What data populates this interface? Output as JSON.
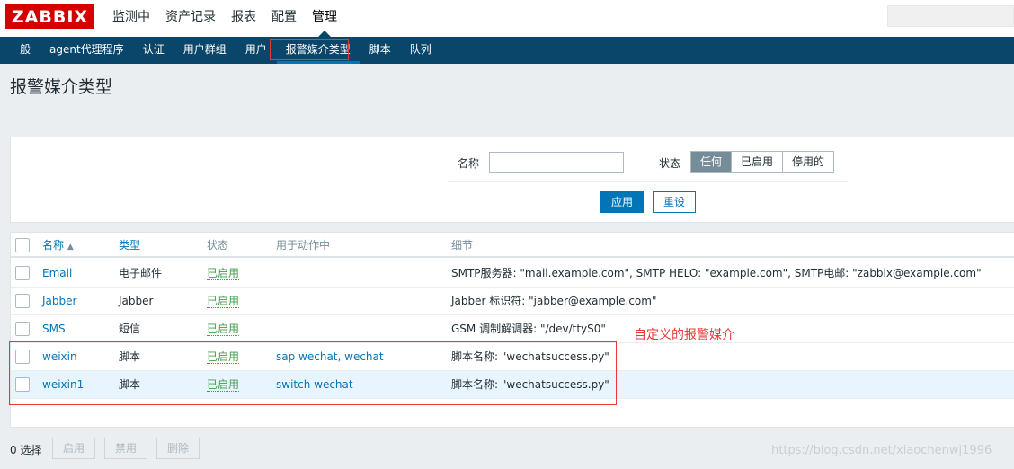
{
  "logo": "ZABBIX",
  "top_nav": [
    "监测中",
    "资产记录",
    "报表",
    "配置",
    "管理"
  ],
  "sub_nav": [
    "一般",
    "agent代理程序",
    "认证",
    "用户群组",
    "用户",
    "报警媒介类型",
    "脚本",
    "队列"
  ],
  "page_title": "报警媒介类型",
  "filter": {
    "name_label": "名称",
    "name_value": "",
    "status_label": "状态",
    "status_options": [
      "任何",
      "已启用",
      "停用的"
    ],
    "status_selected": "任何",
    "apply": "应用",
    "reset": "重设"
  },
  "table": {
    "headers": {
      "name": "名称",
      "sort": "▲",
      "type": "类型",
      "status": "状态",
      "used": "用于动作中",
      "details": "细节"
    },
    "rows": [
      {
        "name": "Email",
        "type": "电子邮件",
        "status": "已启用",
        "used": "",
        "details": "SMTP服务器: \"mail.example.com\", SMTP HELO: \"example.com\", SMTP电邮: \"zabbix@example.com\""
      },
      {
        "name": "Jabber",
        "type": "Jabber",
        "status": "已启用",
        "used": "",
        "details": "Jabber 标识符: \"jabber@example.com\""
      },
      {
        "name": "SMS",
        "type": "短信",
        "status": "已启用",
        "used": "",
        "details": "GSM 调制解调器: \"/dev/ttyS0\""
      },
      {
        "name": "weixin",
        "type": "脚本",
        "status": "已启用",
        "used": "sap wechat, wechat",
        "details": "脚本名称: \"wechatsuccess.py\""
      },
      {
        "name": "weixin1",
        "type": "脚本",
        "status": "已启用",
        "used": "switch wechat",
        "details": "脚本名称: \"wechatsuccess.py\""
      }
    ]
  },
  "annotation": "自定义的报警媒介",
  "footer": {
    "selected": "0 选择",
    "enable": "启用",
    "disable": "禁用",
    "delete": "删除"
  },
  "watermark": "https://blog.csdn.net/xiaochenwj1996",
  "colors": {
    "header_bg": "#0a466a",
    "accent": "#0275b8",
    "enabled": "#429e47",
    "highlight": "#e43a3a"
  }
}
